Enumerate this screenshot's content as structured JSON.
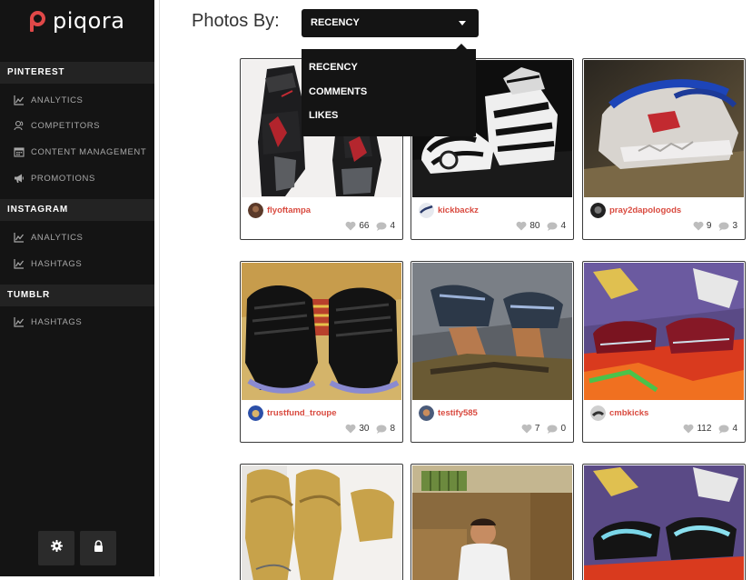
{
  "brand": {
    "name": "piqora",
    "accent": "#e04848"
  },
  "sidebar": {
    "sections": [
      {
        "title": "PINTEREST",
        "items": [
          "ANALYTICS",
          "COMPETITORS",
          "CONTENT MANAGEMENT",
          "PROMOTIONS"
        ]
      },
      {
        "title": "INSTAGRAM",
        "items": [
          "ANALYTICS",
          "HASHTAGS"
        ]
      },
      {
        "title": "TUMBLR",
        "items": [
          "HASHTAGS"
        ]
      }
    ],
    "bottom_buttons": [
      "gear-icon",
      "lock-icon"
    ]
  },
  "header": {
    "label": "Photos By:",
    "selected": "RECENCY",
    "options": [
      "RECENCY",
      "COMMENTS",
      "LIKES"
    ]
  },
  "photos": [
    {
      "user": "flyoftampa",
      "likes": "66",
      "comments": "4"
    },
    {
      "user": "kickbackz",
      "likes": "80",
      "comments": "4"
    },
    {
      "user": "pray2dapologods",
      "likes": "9",
      "comments": "3"
    },
    {
      "user": "trustfund_troupe",
      "likes": "30",
      "comments": "8"
    },
    {
      "user": "testify585",
      "likes": "7",
      "comments": "0"
    },
    {
      "user": "cmbkicks",
      "likes": "112",
      "comments": "4"
    }
  ],
  "colors": {
    "sidebar_bg": "#141414",
    "section_bg": "#232323",
    "username": "#d94a3f"
  }
}
